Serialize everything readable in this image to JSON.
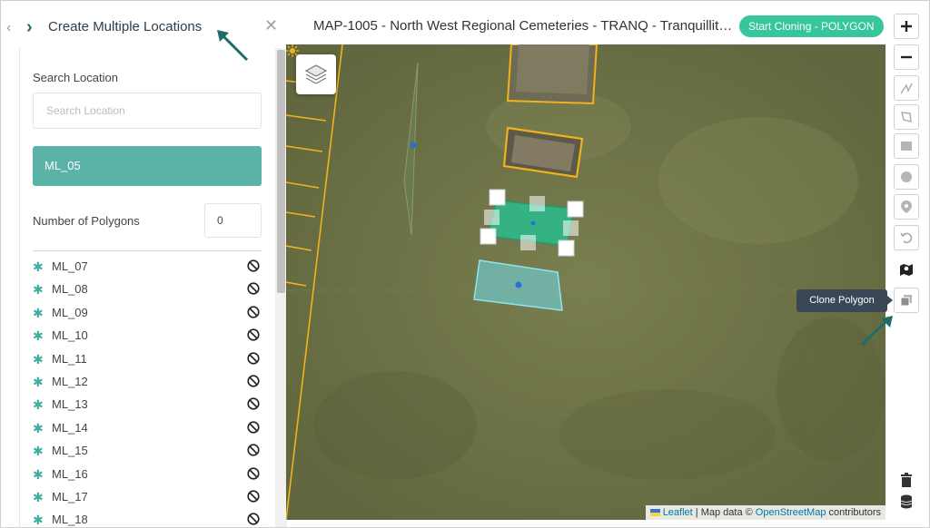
{
  "header": {
    "panel_title": "Create Multiple Locations",
    "map_title": "MAP-1005 - North West Regional Cemeteries - TRANQ - Tranquillity...",
    "clone_badge": "Start Cloning - POLYGON"
  },
  "panel": {
    "search_label": "Search Location",
    "search_placeholder": "Search Location",
    "selected_location": "ML_05",
    "polygons_label": "Number of Polygons",
    "polygons_value": "0",
    "locations": [
      {
        "name": "ML_07"
      },
      {
        "name": "ML_08"
      },
      {
        "name": "ML_09"
      },
      {
        "name": "ML_10"
      },
      {
        "name": "ML_11"
      },
      {
        "name": "ML_12"
      },
      {
        "name": "ML_13"
      },
      {
        "name": "ML_14"
      },
      {
        "name": "ML_15"
      },
      {
        "name": "ML_16"
      },
      {
        "name": "ML_17"
      },
      {
        "name": "ML_18"
      }
    ]
  },
  "map": {
    "attribution_leaflet": "Leaflet",
    "attribution_text": "| Map data ©",
    "attribution_osm": "OpenStreetMap",
    "attribution_contrib": "contributors",
    "tooltip": "Clone Polygon"
  },
  "icons": {
    "zoom_in": "plus-icon",
    "zoom_out": "minus-icon",
    "draw_polyline": "polyline-icon",
    "draw_polygon": "polygon-icon",
    "draw_rectangle": "rectangle-icon",
    "draw_circle": "circle-icon",
    "draw_marker": "marker-icon",
    "undo": "undo-icon",
    "map_layers": "map-icon",
    "clone": "clone-icon",
    "delete": "trash-icon",
    "database": "database-icon"
  },
  "colors": {
    "accent": "#37c59b",
    "selected": "#5bb3a8",
    "tooltip": "#3a4756",
    "boundary": "#f2b21b"
  }
}
